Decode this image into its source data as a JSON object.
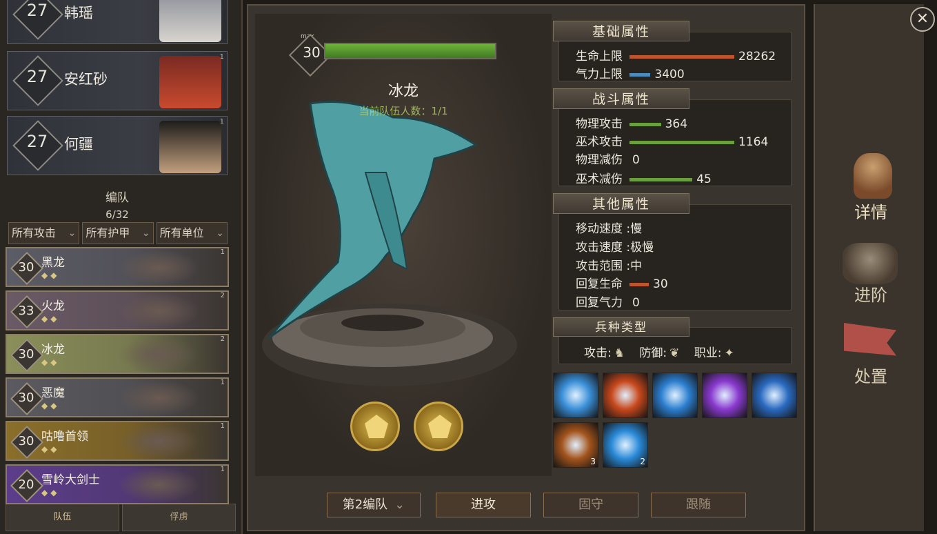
{
  "heroes": [
    {
      "level": "27",
      "name": "韩瑶"
    },
    {
      "level": "27",
      "name": "安红砂",
      "corner": "1"
    },
    {
      "level": "27",
      "name": "何疆",
      "corner": "1"
    }
  ],
  "formation": {
    "title": "编队",
    "count": "6/32"
  },
  "filters": [
    "所有攻击",
    "所有护甲",
    "所有单位"
  ],
  "units": [
    {
      "level": "30",
      "name": "黑龙",
      "corner": "1",
      "color": "#5c5c66"
    },
    {
      "level": "33",
      "name": "火龙",
      "corner": "2",
      "color": "#6a5a66"
    },
    {
      "level": "30",
      "name": "冰龙",
      "corner": "2",
      "color": "#8a8f5a"
    },
    {
      "level": "30",
      "name": "恶魔",
      "corner": "1",
      "color": "#5a5a60"
    },
    {
      "level": "30",
      "name": "咕噜首领",
      "corner": "1",
      "color": "#8a6e2a"
    },
    {
      "level": "20",
      "name": "雪岭大剑士",
      "corner": "1",
      "color": "#5c3d8a"
    }
  ],
  "bottom_tabs": [
    "队伍",
    "俘虏"
  ],
  "unit_detail": {
    "max_label": "max",
    "level": "30",
    "hp_fill": 1.0,
    "name": "冰龙",
    "team_count_text": "当前队伍人数：1/1"
  },
  "sections": {
    "basic": "基础属性",
    "combat": "战斗属性",
    "other": "其他属性",
    "troop": "兵种类型"
  },
  "basic": {
    "hp_label": "生命上限",
    "hp_value": "28262",
    "hp_bar": 1.0,
    "mp_label": "气力上限",
    "mp_value": "3400",
    "mp_bar": 0.2
  },
  "combat": {
    "patk_label": "物理攻击",
    "patk_value": "364",
    "patk_bar": 0.3,
    "matk_label": "巫术攻击",
    "matk_value": "1164",
    "matk_bar": 1.0,
    "pdef_label": "物理减伤",
    "pdef_value": "0",
    "mdef_label": "巫术减伤",
    "mdef_value": "45",
    "mdef_bar": 0.6
  },
  "other": {
    "move": "移动速度 :慢",
    "atkspd": "攻击速度 :极慢",
    "range": "攻击范围 :中",
    "regen_hp_label": "回复生命",
    "regen_hp_value": "30",
    "regen_mp_label": "回复气力",
    "regen_mp_value": "0"
  },
  "troop": {
    "attack": "攻击:",
    "defense": "防御:",
    "job": "职业:"
  },
  "skills": [
    {
      "icon": "ice-crystal-icon",
      "color": "#3a8fd8"
    },
    {
      "icon": "fire-dragon-icon",
      "color": "#c8481c"
    },
    {
      "icon": "ice-wolf-icon",
      "color": "#2c7fd0"
    },
    {
      "icon": "purple-spirit-icon",
      "color": "#8a3ad0"
    },
    {
      "icon": "blue-ring-icon",
      "color": "#2a6ac0"
    },
    {
      "icon": "ram-helmet-icon",
      "color": "#a3541c",
      "count": "3"
    },
    {
      "icon": "shield-rune-icon",
      "color": "#2a8ad8",
      "count": "2"
    }
  ],
  "buttons": {
    "team": "第2编队",
    "attack": "进攻",
    "hold": "固守",
    "follow": "跟随"
  },
  "right_menu": [
    "详情",
    "进阶",
    "处置"
  ],
  "close": "✕"
}
